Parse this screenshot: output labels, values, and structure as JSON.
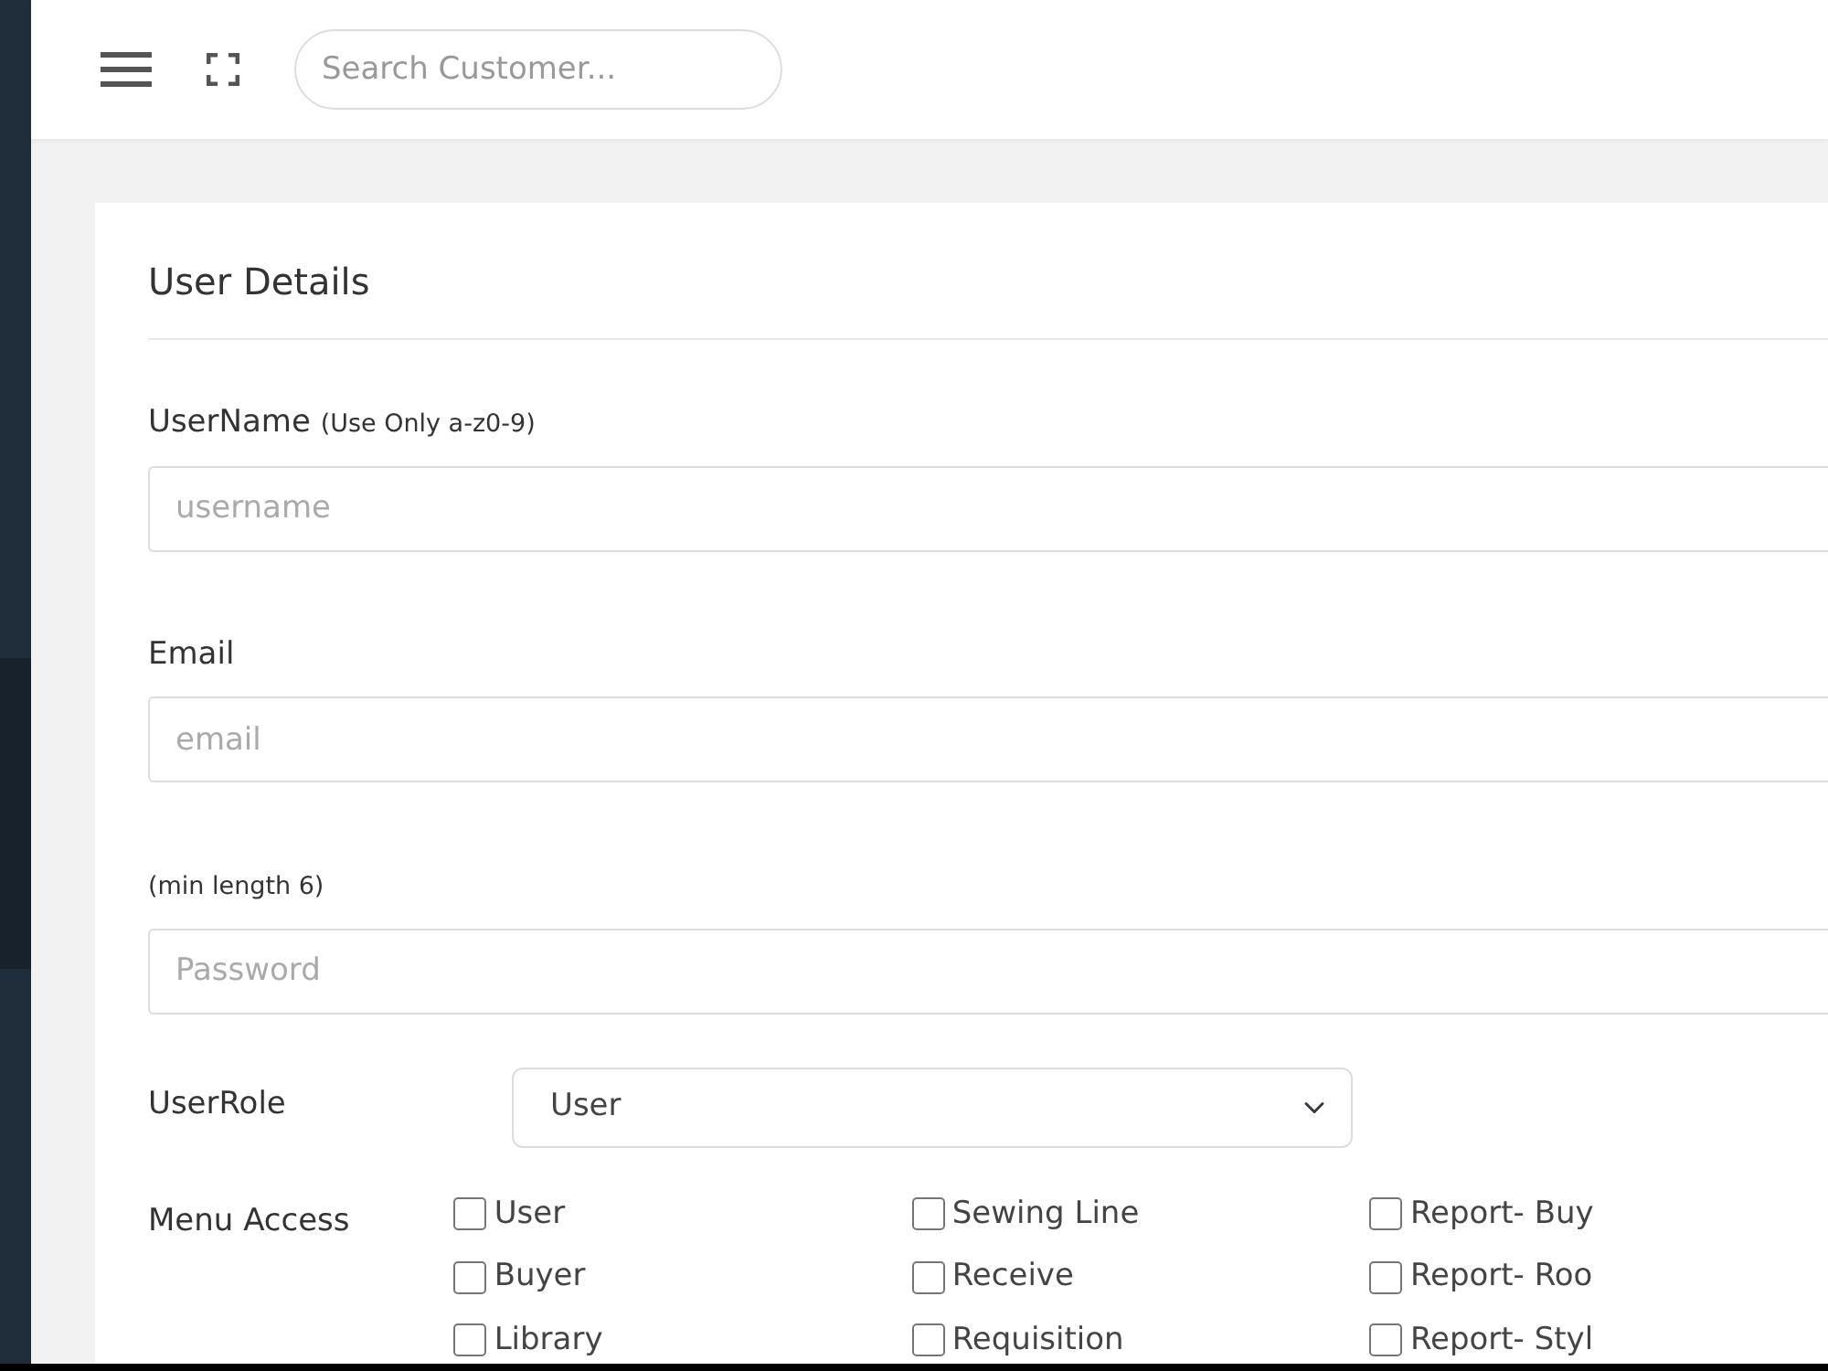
{
  "topbar": {
    "search": {
      "placeholder": "Search Customer..."
    }
  },
  "card": {
    "title": "User Details",
    "fields": [
      {
        "kind": "text",
        "label": "UserName",
        "hint": "(Use Only a-z0-9)",
        "placeholder": "username"
      },
      {
        "kind": "text",
        "label": "Email",
        "placeholder": "email"
      },
      {
        "kind": "text",
        "hint": "(min length 6)",
        "placeholder": "Password"
      }
    ],
    "user_role": {
      "label": "UserRole",
      "value": "User"
    },
    "menu_access": {
      "label": "Menu Access",
      "columns": [
        [
          {
            "label": "User",
            "checked": false
          },
          {
            "label": "Buyer",
            "checked": false
          },
          {
            "label": "Library",
            "checked": false
          }
        ],
        [
          {
            "label": "Sewing Line",
            "checked": false
          },
          {
            "label": "Receive",
            "checked": false
          },
          {
            "label": "Requisition",
            "checked": false
          }
        ],
        [
          {
            "label": "Report- Buy",
            "checked": false
          },
          {
            "label": "Report- Roo",
            "checked": false
          },
          {
            "label": "Report- Styl",
            "checked": false
          }
        ]
      ]
    }
  }
}
